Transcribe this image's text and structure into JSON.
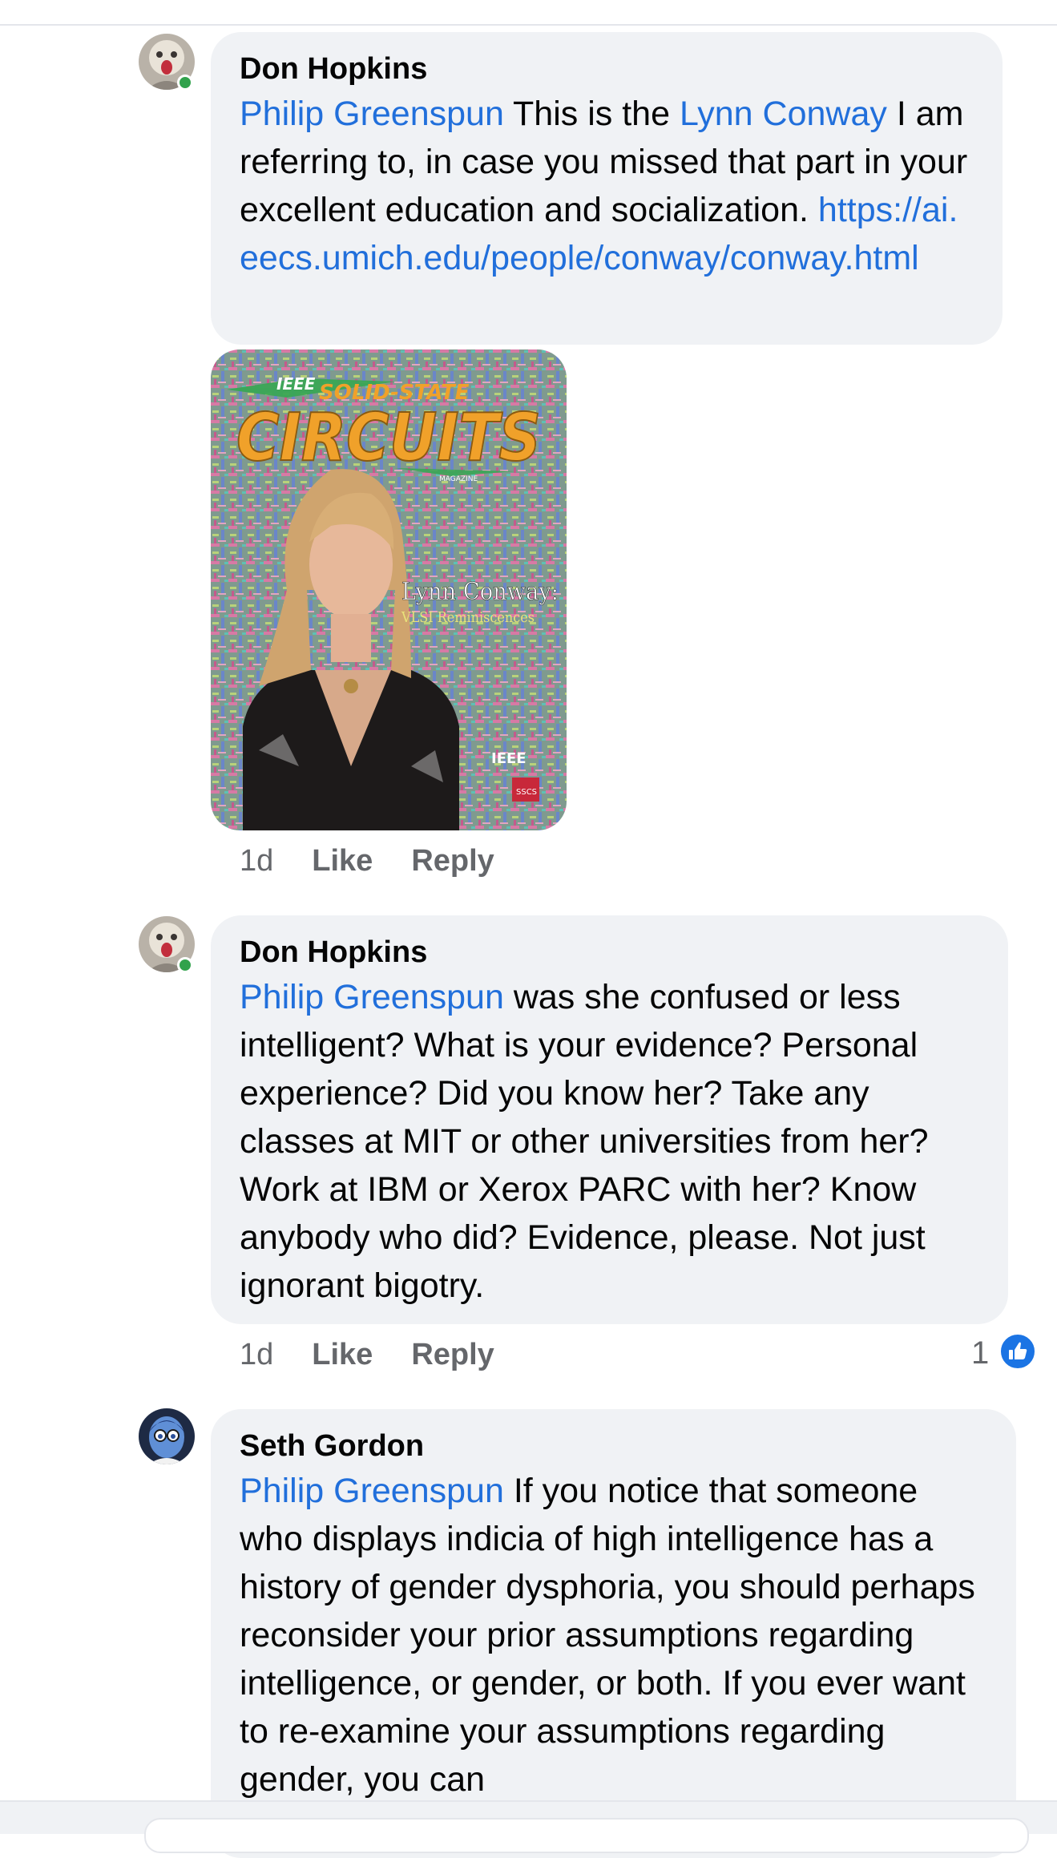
{
  "comments": [
    {
      "author": "Don Hopkins",
      "mention": "Philip Greenspun",
      "text_a": " This is the ",
      "link_name": "Lynn Conway",
      "text_b": " I am referring to, in case you missed that part in your excellent education and socialization. ",
      "url": "https://ai.eecs.umich.edu/people/conway/conway.html",
      "time": "1d",
      "like_label": "Like",
      "reply_label": "Reply"
    },
    {
      "author": "Don Hopkins",
      "mention": "Philip Greenspun",
      "text": " was she confused or less intelligent? What is your evidence? Personal experience? Did you know her? Take any classes at MIT or other universities from her? Work at IBM or Xerox PARC with her? Know anybody who did? Evidence, please. Not just ignorant bigotry.",
      "time": "1d",
      "like_label": "Like",
      "reply_label": "Reply",
      "reaction_count": "1"
    },
    {
      "author": "Seth Gordon",
      "mention": "Philip Greenspun",
      "text": " If you notice that someone who displays indicia of high intelligence has a history of gender dysphoria, you should perhaps reconsider your prior assumptions regarding intelligence, or gender, or both. If you ever want to re-examine your assumptions regarding gender, you can"
    }
  ],
  "attachment": {
    "brand": "IEEE",
    "top_line": "SOLID-STATE",
    "title": "CIRCUITS",
    "subtitle_tag": "MAGAZINE",
    "headline": "Lynn Conway:",
    "subheadline": "VLSI Reminiscences",
    "publisher": "IEEE",
    "society": "SSCS"
  },
  "icons": {
    "reaction": "like-thumb-icon",
    "presence": "online-status-icon"
  },
  "colors": {
    "link": "#216fdb",
    "bubble": "#f0f2f5",
    "meta": "#65676b",
    "online": "#31a24c",
    "like": "#1b74e4",
    "magazine_title": "#f0a12a"
  }
}
